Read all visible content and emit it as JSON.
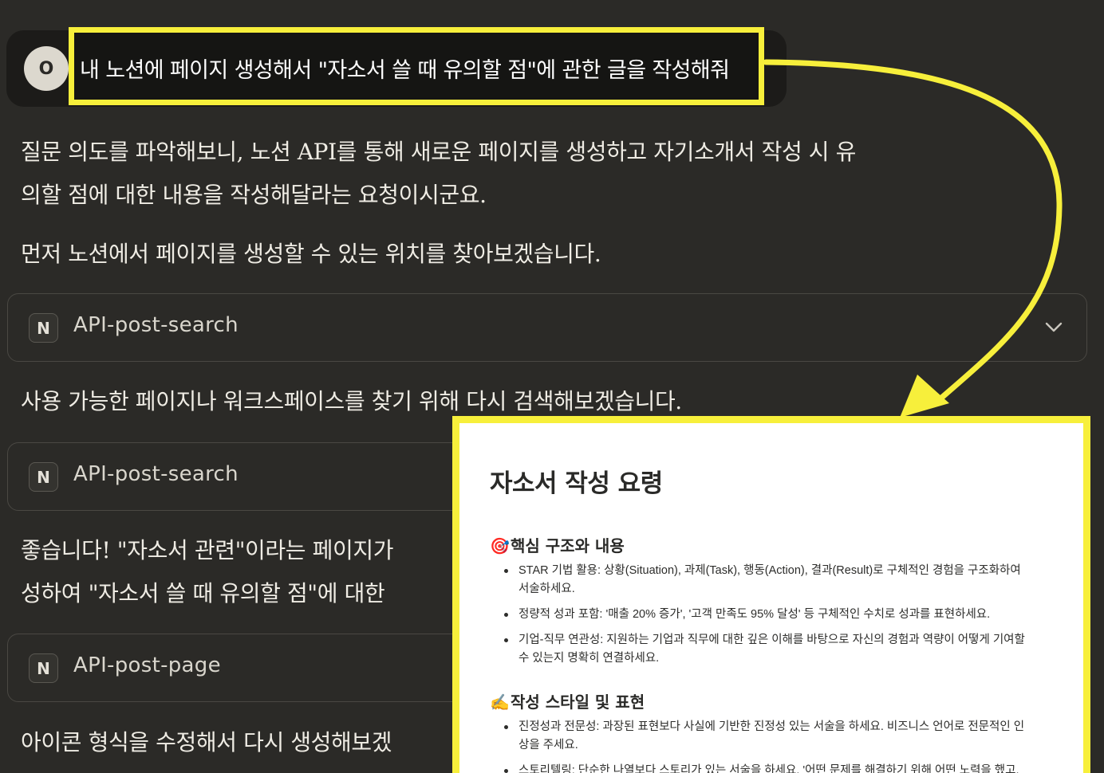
{
  "user_message": {
    "avatar_initial": "O",
    "text": "내 노션에 페이지 생성해서 \"자소서 쓸 때 유의할 점\"에 관한 글을 작성해줘"
  },
  "assistant": {
    "para1_line1": "질문 의도를 파악해보니, 노션 API를 통해 새로운 페이지를 생성하고 자기소개서 작성 시 유",
    "para1_line2": "의할 점에 대한 내용을 작성해달라는 요청이시군요.",
    "para2": "먼저 노션에서 페이지를 생성할 수 있는 위치를 찾아보겠습니다.",
    "para3": "사용 가능한 페이지나 워크스페이스를 찾기 위해 다시 검색해보겠습니다.",
    "para4_line1": "좋습니다! \"자소서 관련\"이라는 페이지가",
    "para4_line2": "성하여 \"자소서 쓸 때 유의할 점\"에 대한",
    "para5": "아이콘 형식을 수정해서 다시 생성해보겠"
  },
  "tool_calls": [
    {
      "badge": "N",
      "name": "API-post-search"
    },
    {
      "badge": "N",
      "name": "API-post-search"
    },
    {
      "badge": "N",
      "name": "API-post-page"
    }
  ],
  "icons": {
    "chevron": "chevron-down-icon",
    "notion": "notion-icon"
  },
  "colors": {
    "highlight": "#f7ef3b",
    "background": "#2b2a27"
  },
  "notion_page": {
    "title": "자소서 작성 요령",
    "section1": {
      "emoji": "🎯",
      "heading": "핵심 구조와 내용",
      "items": [
        "STAR 기법 활용: 상황(Situation), 과제(Task), 행동(Action), 결과(Result)로 구체적인 경험을 구조화하여 서술하세요.",
        "정량적 성과 포함: '매출 20% 증가', '고객 만족도 95% 달성' 등 구체적인 수치로 성과를 표현하세요.",
        "기업-직무 연관성: 지원하는 기업과 직무에 대한 깊은 이해를 바탕으로 자신의 경험과 역량이 어떻게 기여할 수 있는지 명확히 연결하세요."
      ]
    },
    "section2": {
      "emoji": "✍️",
      "heading": "작성 스타일 및 표현",
      "items": [
        "진정성과 전문성: 과장된 표현보다 사실에 기반한 진정성 있는 서술을 하세요. 비즈니스 언어로 전문적인 인상을 주세요.",
        "스토리텔링: 단순한 나열보다 스토리가 있는 서술을 하세요. '어떤 문제를 해결하기 위해 어떤 노력을 했고, 그"
      ]
    }
  }
}
